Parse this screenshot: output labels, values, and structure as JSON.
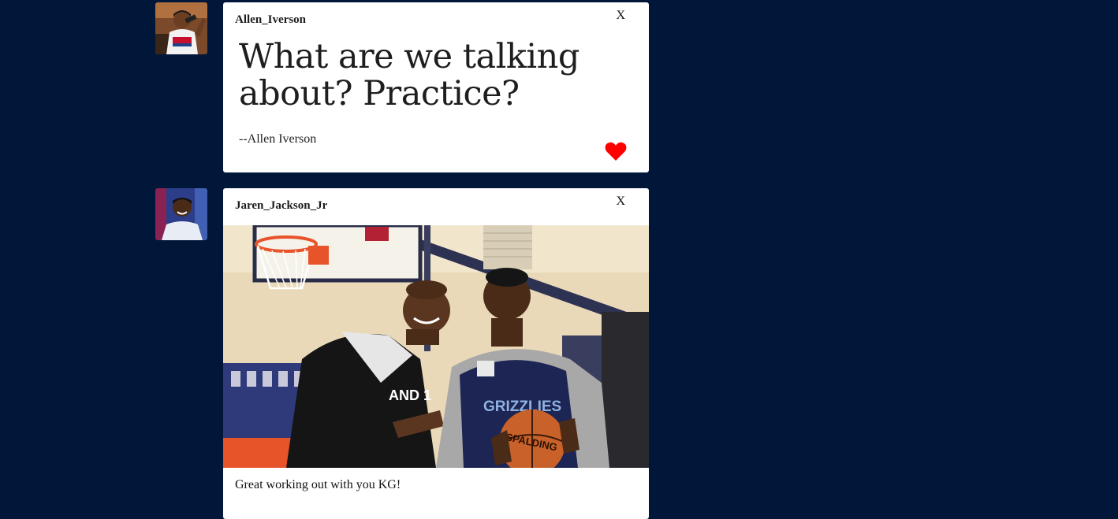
{
  "colors": {
    "background": "#00173a",
    "card": "#ffffff",
    "heart": "#ff0000"
  },
  "posts": [
    {
      "username": "Allen_Iverson",
      "close_label": "X",
      "quote": "What are we talking about? Practice?",
      "source": "--Allen Iverson",
      "liked": true
    },
    {
      "username": "Jaren_Jackson_Jr",
      "close_label": "X",
      "caption": "Great working out with you KG!",
      "photo_jersey_text": "GRIZZLIES",
      "photo_shirt_text": "AND 1",
      "photo_ball_text": "SPALDING"
    }
  ]
}
